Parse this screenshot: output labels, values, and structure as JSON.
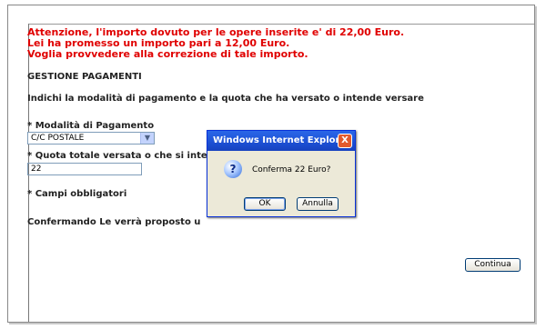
{
  "warning": {
    "line1": "Attenzione, l'importo dovuto per le opere inserite e' di 22,00 Euro.",
    "line2": "Lei ha promesso un importo pari a 12,00 Euro.",
    "line3": "Voglia provvedere alla correzione di tale importo."
  },
  "section_title": "GESTIONE PAGAMENTI",
  "instructions": "Indichi la modalità di pagamento e la quota che ha versato o intende versare",
  "payment_method": {
    "label": "* Modalità di Pagamento",
    "selected": "C/C POSTALE"
  },
  "amount": {
    "label": "* Quota totale versata o che si inte",
    "value": "22"
  },
  "required_note": "* Campi obbligatori",
  "confirm_text": "Confermando Le verrà proposto u",
  "confirm_text_tail": "",
  "continue_label": "Continua",
  "dialog": {
    "title": "Windows Internet Explorer",
    "message": "Conferma 22 Euro?",
    "ok_label": "OK",
    "cancel_label": "Annulla",
    "close_glyph": "X",
    "icon": "question-icon",
    "icon_glyph": "?"
  }
}
